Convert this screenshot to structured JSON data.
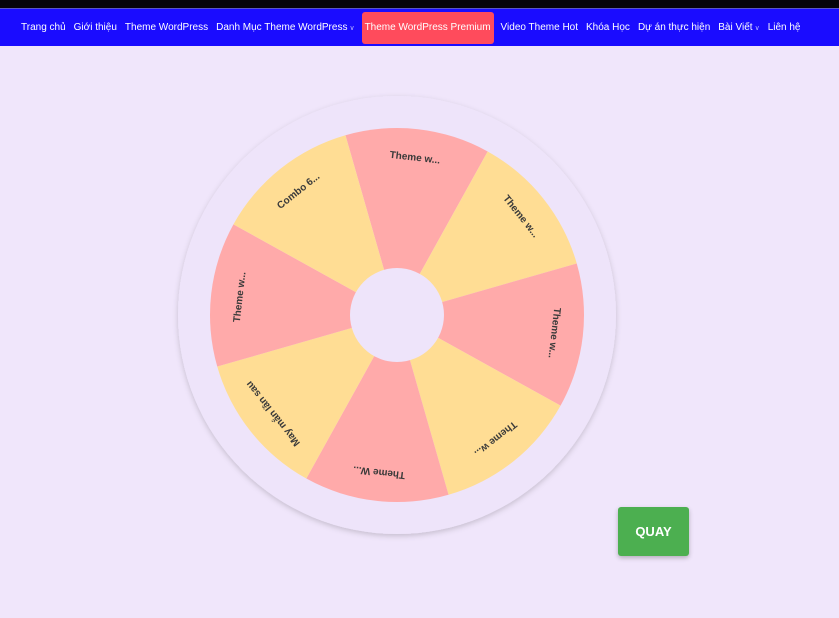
{
  "nav": {
    "items": [
      {
        "label": "Trang chủ"
      },
      {
        "label": "Giới thiệu"
      },
      {
        "label": "Theme WordPress"
      },
      {
        "label": "Danh Mục Theme WordPress",
        "dropdown": true
      },
      {
        "label": "Theme WordPress Premium",
        "active": true
      },
      {
        "label": "Video Theme Hot"
      },
      {
        "label": "Khóa Học"
      },
      {
        "label": "Dự án thực hiện"
      },
      {
        "label": "Bài Viết",
        "dropdown": true
      },
      {
        "label": "Liên hệ"
      }
    ],
    "dropdown_icon": "chevron-down-icon",
    "bg_color": "#1a0cff",
    "active_color": "#ff4b5c"
  },
  "wheel": {
    "segments": [
      {
        "label": "Theme w...",
        "color": "#ffaaaa"
      },
      {
        "label": "Theme w...",
        "color": "#ffdd94"
      },
      {
        "label": "Theme w...",
        "color": "#ffaaaa"
      },
      {
        "label": "Theme w...",
        "color": "#ffdd94"
      },
      {
        "label": "Theme W...",
        "color": "#ffaaaa"
      },
      {
        "label": "May mắn lần sau",
        "color": "#ffdd94"
      },
      {
        "label": "Theme w...",
        "color": "#ffaaaa"
      },
      {
        "label": "Combo 6...",
        "color": "#ffdd94"
      }
    ]
  },
  "spin_button": {
    "label": "QUAY",
    "color": "#4caf50"
  }
}
